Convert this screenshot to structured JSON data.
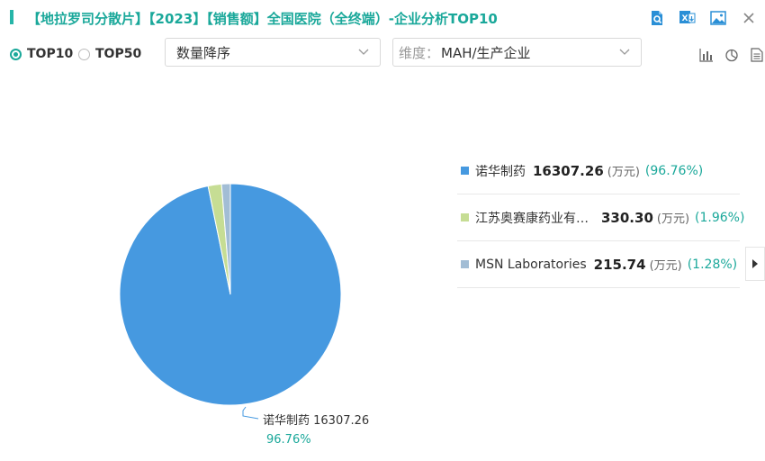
{
  "header": {
    "title": "【地拉罗司分散片】【2023】【销售额】全国医院（全终端）-企业分析TOP10",
    "accent_color": "#26b5a8",
    "icons": [
      "search-doc-icon",
      "excel-export-icon",
      "image-export-icon",
      "close-icon"
    ]
  },
  "controls": {
    "radio_top10": "TOP10",
    "radio_top50": "TOP50",
    "selected": "TOP10",
    "sort_select": "数量降序",
    "dimension_prefix": "维度：",
    "dimension_value": "MAH/生产企业",
    "chart_type_icons": [
      "bar-chart-icon",
      "pie-chart-icon",
      "table-icon"
    ]
  },
  "chart_data": {
    "type": "pie",
    "unit": "(万元)",
    "slices": [
      {
        "name": "诺华制药",
        "display_name": "诺华制药",
        "value": 16307.26,
        "value_text": "16307.26",
        "percent": "(96.76%)",
        "percent_value": 96.76,
        "color": "#4699e0"
      },
      {
        "name": "江苏奥赛康药业有限公司",
        "display_name": "江苏奥赛康药业有…",
        "value": 330.3,
        "value_text": "330.30",
        "percent": "(1.96%)",
        "percent_value": 1.96,
        "color": "#c6dd94"
      },
      {
        "name": "MSN Laboratories",
        "display_name": "MSN Laboratories",
        "value": 215.74,
        "value_text": "215.74",
        "percent": "(1.28%)",
        "percent_value": 1.28,
        "color": "#a2bdd5"
      }
    ],
    "callout": {
      "label": "诺华制药 16307.26",
      "percent": "96.76%"
    }
  }
}
